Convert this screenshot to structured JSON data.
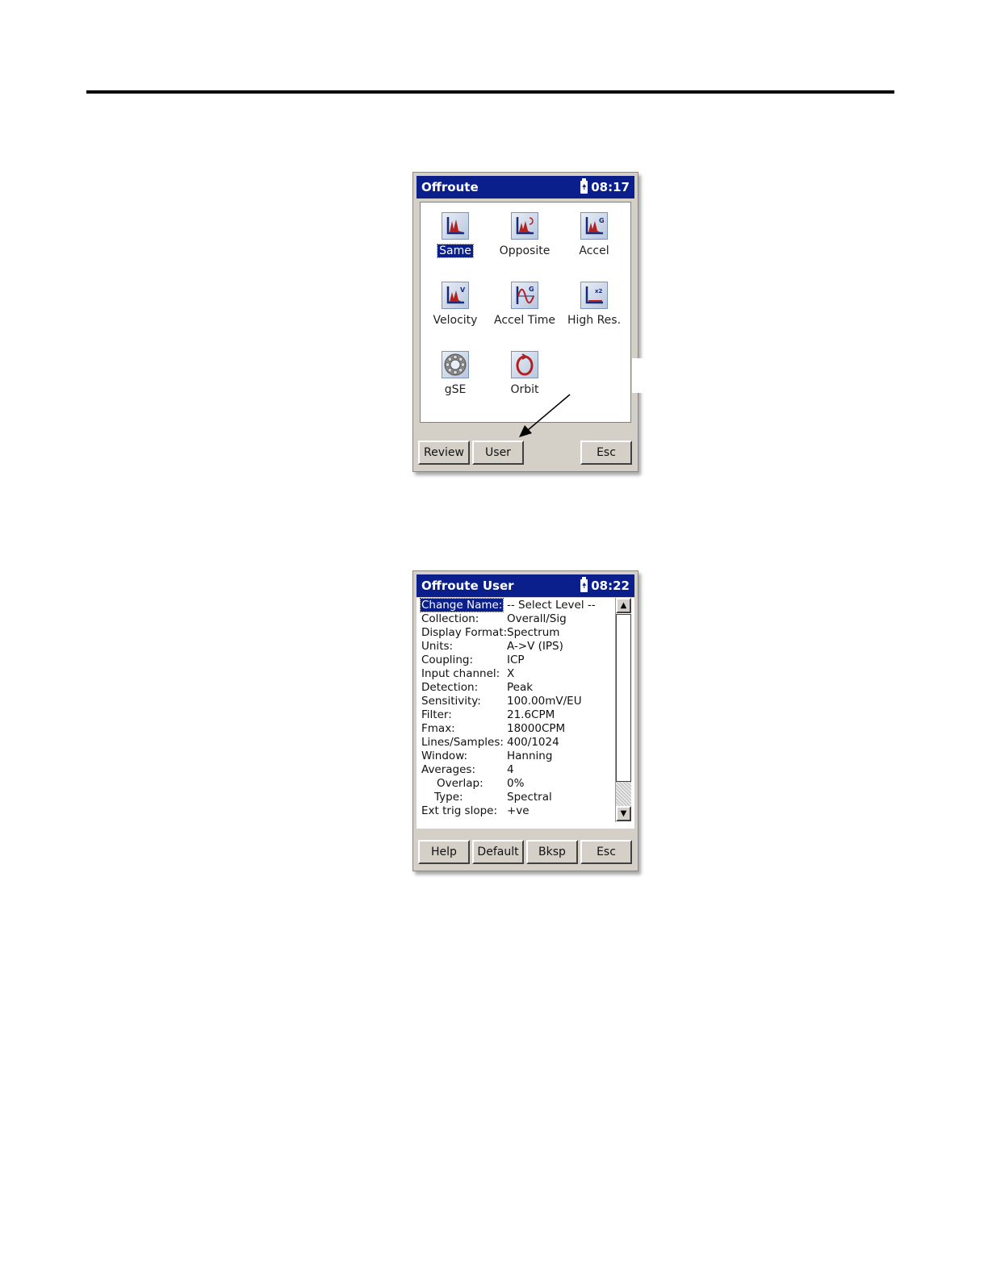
{
  "screen1": {
    "title": "Offroute",
    "time": "08:17",
    "icons": [
      {
        "label": "Same",
        "icon": "spectrum-icon",
        "selected": true
      },
      {
        "label": "Opposite",
        "icon": "spectrum-opposite-icon"
      },
      {
        "label": "Accel",
        "icon": "spectrum-accel-icon"
      },
      {
        "label": "Velocity",
        "icon": "spectrum-velocity-icon"
      },
      {
        "label": "Accel Time",
        "icon": "waveform-icon"
      },
      {
        "label": "High Res.",
        "icon": "high-res-icon"
      },
      {
        "label": "gSE",
        "icon": "bearing-icon"
      },
      {
        "label": "Orbit",
        "icon": "orbit-icon"
      }
    ],
    "buttons": {
      "review": "Review",
      "user": "User",
      "esc": "Esc"
    }
  },
  "screen2": {
    "title": "Offroute User",
    "time": "08:22",
    "rows": [
      {
        "key": "Change Name:",
        "value": "-- Select Level --"
      },
      {
        "key": "Collection:",
        "value": "Overall/Sig"
      },
      {
        "key": "Display Format:",
        "value": "Spectrum"
      },
      {
        "key": "Units:",
        "value": "A->V (IPS)"
      },
      {
        "key": "Coupling:",
        "value": "ICP"
      },
      {
        "key": "Input channel:",
        "value": "X"
      },
      {
        "key": "Detection:",
        "value": "Peak"
      },
      {
        "key": "Sensitivity:",
        "value": "100.00mV/EU"
      },
      {
        "key": "Filter:",
        "value": "21.6CPM"
      },
      {
        "key": "Fmax:",
        "value": "18000CPM"
      },
      {
        "key": "Lines/Samples:",
        "value": "400/1024"
      },
      {
        "key": "Window:",
        "value": "Hanning"
      },
      {
        "key": "Averages:",
        "value": "4"
      },
      {
        "key": "Overlap:",
        "value": "0%"
      },
      {
        "key": "Type:",
        "value": "Spectral"
      },
      {
        "key": "Ext trig slope:",
        "value": "+ve"
      }
    ],
    "buttons": {
      "help": "Help",
      "default": "Default",
      "bksp": "Bksp",
      "esc": "Esc"
    },
    "scroll_position": 0
  }
}
